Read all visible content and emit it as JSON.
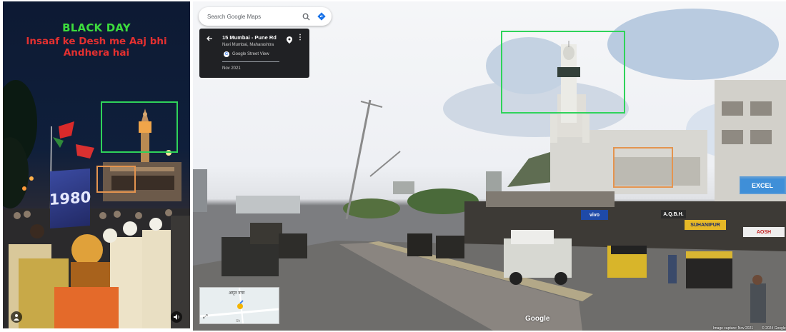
{
  "video": {
    "caption_line1": "BLACK DAY",
    "caption_line2": "Insaaf ke Desh me Aaj bhi Andhera hai",
    "banner_text": "1980"
  },
  "street_view": {
    "search_placeholder": "Search Google Maps",
    "location_title": "15 Mumbai - Pune Rd",
    "location_subtitle": "Navi Mumbai, Maharashtra",
    "source_label": "Google Street View",
    "date": "Nov 2021",
    "minimap_label": "अमृत नगर",
    "minimap_footer": "Sh",
    "google_wordmark": "Google",
    "image_capture": "Image capture: Nov 2021",
    "copyright": "© 2024 Google",
    "signs": {
      "vivo": "vivo",
      "aqbh": "A.Q.B.H.",
      "shop": "SUHANIPUR",
      "jeddah": "EXCEL",
      "aosh": "AOSH"
    }
  },
  "colors": {
    "highlight_green": "#2fd35a",
    "highlight_orange": "#e4944f",
    "caption_green": "#3ddc3d",
    "caption_red": "#e43030",
    "card_bg": "#202124"
  },
  "icons": [
    "search-icon",
    "directions-icon",
    "back-arrow-icon",
    "pin-icon",
    "more-vert-icon",
    "expand-icon",
    "person-icon",
    "sound-icon"
  ]
}
